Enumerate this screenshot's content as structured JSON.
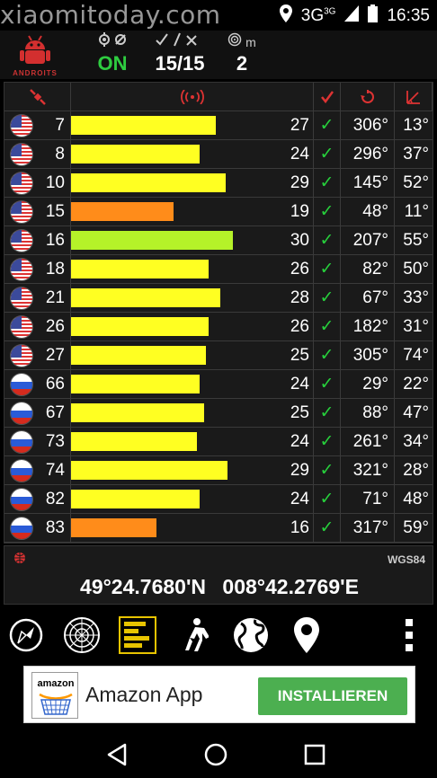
{
  "status_bar": {
    "watermark": "xiaomitoday.com",
    "network": "3G",
    "network_sup": "3G",
    "time": "16:35",
    "icons": [
      "location-icon",
      "signal-icon",
      "battery-icon"
    ]
  },
  "app_header": {
    "logo_text": "ANDROITS",
    "status_value": "ON",
    "used_in_view": "15/15",
    "accuracy_unit": "m",
    "accuracy_value": "2",
    "status_color": "#2ecc40"
  },
  "table": {
    "headers": [
      "satellite-icon",
      "signal-icon",
      "used-icon",
      "azimuth-icon",
      "elevation-icon"
    ],
    "rows": [
      {
        "flag": "us",
        "prn": "7",
        "snr": "27",
        "bar": 0.61,
        "bar_color": "#ffff22",
        "used": "✓",
        "azimuth": "306°",
        "elevation": "13°"
      },
      {
        "flag": "us",
        "prn": "8",
        "snr": "24",
        "bar": 0.54,
        "bar_color": "#ffff22",
        "used": "✓",
        "azimuth": "296°",
        "elevation": "37°"
      },
      {
        "flag": "us",
        "prn": "10",
        "snr": "29",
        "bar": 0.65,
        "bar_color": "#ffff22",
        "used": "✓",
        "azimuth": "145°",
        "elevation": "52°"
      },
      {
        "flag": "us",
        "prn": "15",
        "snr": "19",
        "bar": 0.43,
        "bar_color": "#ff8c1a",
        "used": "✓",
        "azimuth": "48°",
        "elevation": "11°"
      },
      {
        "flag": "us",
        "prn": "16",
        "snr": "30",
        "bar": 0.68,
        "bar_color": "#b5f229",
        "used": "✓",
        "azimuth": "207°",
        "elevation": "55°"
      },
      {
        "flag": "us",
        "prn": "18",
        "snr": "26",
        "bar": 0.58,
        "bar_color": "#ffff22",
        "used": "✓",
        "azimuth": "82°",
        "elevation": "50°"
      },
      {
        "flag": "us",
        "prn": "21",
        "snr": "28",
        "bar": 0.63,
        "bar_color": "#ffff22",
        "used": "✓",
        "azimuth": "67°",
        "elevation": "33°"
      },
      {
        "flag": "us",
        "prn": "26",
        "snr": "26",
        "bar": 0.58,
        "bar_color": "#ffff22",
        "used": "✓",
        "azimuth": "182°",
        "elevation": "31°"
      },
      {
        "flag": "us",
        "prn": "27",
        "snr": "25",
        "bar": 0.57,
        "bar_color": "#ffff22",
        "used": "✓",
        "azimuth": "305°",
        "elevation": "74°"
      },
      {
        "flag": "ru",
        "prn": "66",
        "snr": "24",
        "bar": 0.54,
        "bar_color": "#ffff22",
        "used": "✓",
        "azimuth": "29°",
        "elevation": "22°"
      },
      {
        "flag": "ru",
        "prn": "67",
        "snr": "25",
        "bar": 0.56,
        "bar_color": "#ffff22",
        "used": "✓",
        "azimuth": "88°",
        "elevation": "47°"
      },
      {
        "flag": "ru",
        "prn": "73",
        "snr": "24",
        "bar": 0.53,
        "bar_color": "#ffff22",
        "used": "✓",
        "azimuth": "261°",
        "elevation": "34°"
      },
      {
        "flag": "ru",
        "prn": "74",
        "snr": "29",
        "bar": 0.66,
        "bar_color": "#ffff22",
        "used": "✓",
        "azimuth": "321°",
        "elevation": "28°"
      },
      {
        "flag": "ru",
        "prn": "82",
        "snr": "24",
        "bar": 0.54,
        "bar_color": "#ffff22",
        "used": "✓",
        "azimuth": "71°",
        "elevation": "48°"
      },
      {
        "flag": "ru",
        "prn": "83",
        "snr": "16",
        "bar": 0.36,
        "bar_color": "#ff8c1a",
        "used": "✓",
        "azimuth": "317°",
        "elevation": "59°"
      }
    ]
  },
  "coordinates": {
    "datum": "WGS84",
    "latitude": "49°24.7680'N",
    "longitude": "008°42.2769'E"
  },
  "toolbar": {
    "items": [
      "compass-icon",
      "radar-icon",
      "signal-bars-icon",
      "walking-icon",
      "globe-icon",
      "map-pin-icon",
      "overflow-menu-icon"
    ],
    "active": "signal-bars-icon"
  },
  "ad": {
    "logo_text": "amazon",
    "title": "Amazon App",
    "button": "INSTALLIEREN",
    "button_color": "#4caf50"
  },
  "nav": {
    "items": [
      "back-icon",
      "home-icon",
      "recents-icon"
    ]
  }
}
